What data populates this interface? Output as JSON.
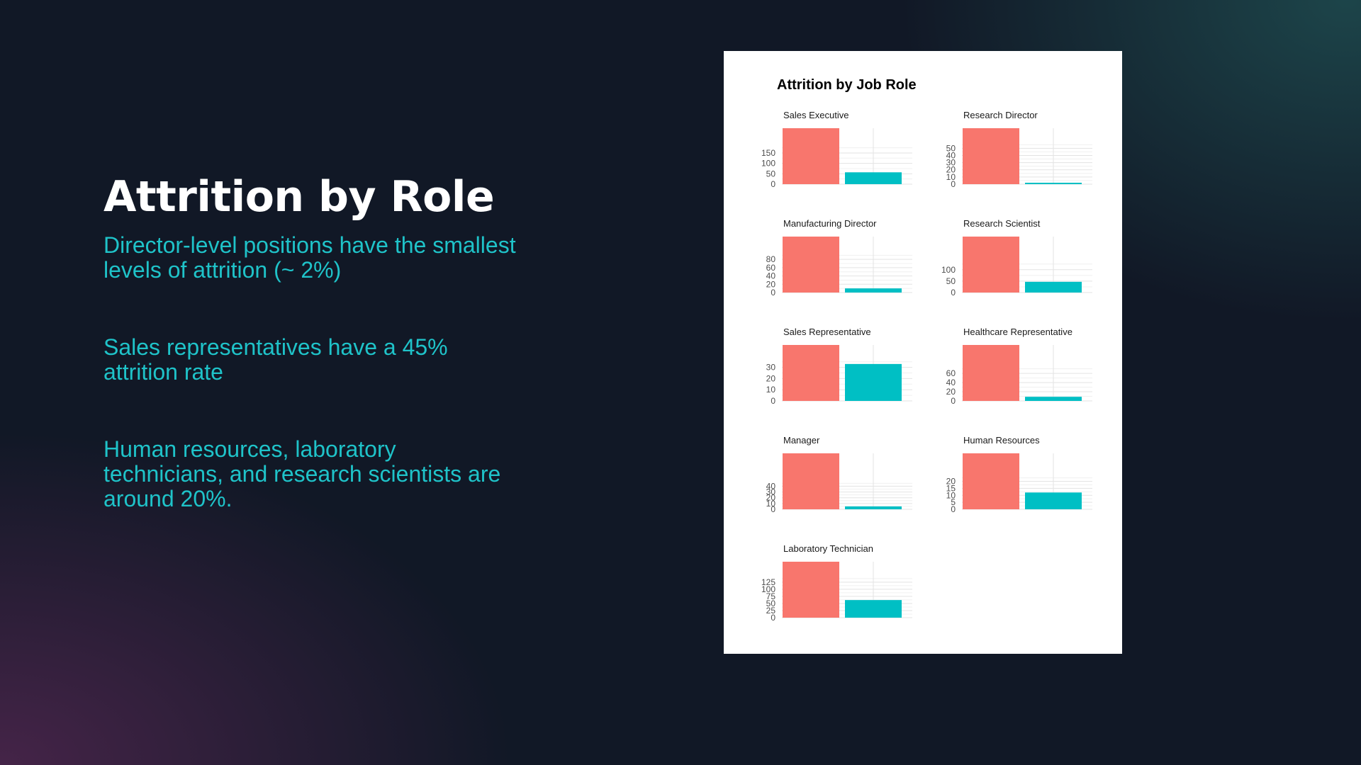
{
  "slide": {
    "title": "Attrition by Role",
    "bullets": [
      "Director-level positions have the smallest levels of attrition (~ 2%)",
      "Sales representatives have a 45% attrition rate",
      "Human resources, laboratory technicians, and research scientists are around 20%."
    ]
  },
  "colors": {
    "no_attrition": "#F8766D",
    "attrition": "#00BFC4",
    "title_text": "#ffffff",
    "bullet_text": "#1fc3c9"
  },
  "chart_data": {
    "type": "bar",
    "title": "Attrition by Job Role",
    "xlabel": "",
    "ylabel": "",
    "legend": "none",
    "grid": true,
    "facets": [
      {
        "name": "Sales Executive",
        "values": [
          269,
          57
        ],
        "ticks": [
          0,
          50,
          100,
          150
        ]
      },
      {
        "name": "Research Director",
        "values": [
          78,
          2
        ],
        "ticks": [
          0,
          10,
          20,
          30,
          40,
          50
        ]
      },
      {
        "name": "Manufacturing Director",
        "values": [
          135,
          10
        ],
        "ticks": [
          0,
          20,
          40,
          60,
          80
        ]
      },
      {
        "name": "Research Scientist",
        "values": [
          245,
          47
        ],
        "ticks": [
          0,
          50,
          100
        ]
      },
      {
        "name": "Sales Representative",
        "values": [
          50,
          33
        ],
        "ticks": [
          0,
          10,
          20,
          30
        ]
      },
      {
        "name": "Healthcare Representative",
        "values": [
          122,
          9
        ],
        "ticks": [
          0,
          20,
          40,
          60
        ]
      },
      {
        "name": "Manager",
        "values": [
          97,
          5
        ],
        "ticks": [
          0,
          10,
          20,
          30,
          40
        ]
      },
      {
        "name": "Human Resources",
        "values": [
          40,
          12
        ],
        "ticks": [
          0,
          5,
          10,
          15,
          20
        ]
      },
      {
        "name": "Laboratory Technician",
        "values": [
          197,
          62
        ],
        "ticks": [
          0,
          25,
          50,
          75,
          100,
          125
        ]
      }
    ]
  }
}
